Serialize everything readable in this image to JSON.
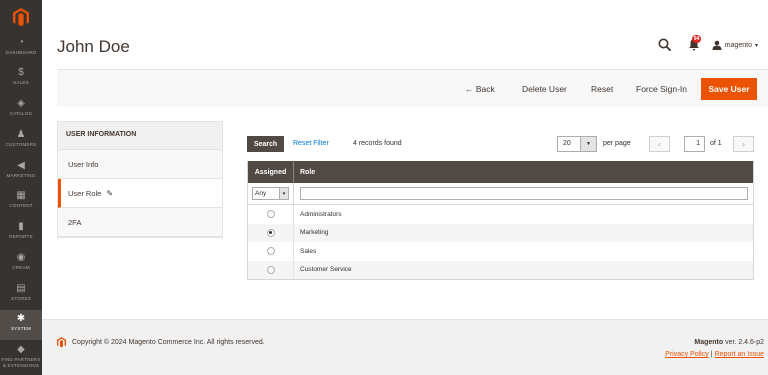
{
  "sidebar": {
    "items": [
      {
        "label": "DASHBOARD",
        "icon": "dashboard-icon",
        "glyph": "◔"
      },
      {
        "label": "SALES",
        "icon": "dollar-icon",
        "glyph": "$"
      },
      {
        "label": "CATALOG",
        "icon": "cube-icon",
        "glyph": "◈"
      },
      {
        "label": "CUSTOMERS",
        "icon": "person-icon",
        "glyph": "♟"
      },
      {
        "label": "MARKETING",
        "icon": "megaphone-icon",
        "glyph": "◀"
      },
      {
        "label": "CONTENT",
        "icon": "content-icon",
        "glyph": "▦"
      },
      {
        "label": "REPORTS",
        "icon": "bar-chart-icon",
        "glyph": "▮"
      },
      {
        "label": "CREAM",
        "icon": "cream-icon",
        "glyph": "◉"
      },
      {
        "label": "STORES",
        "icon": "store-icon",
        "glyph": "▤"
      },
      {
        "label": "SYSTEM",
        "icon": "gear-icon",
        "glyph": "✱"
      },
      {
        "label": "FIND PARTNERS & EXTENSIONS",
        "icon": "extensions-icon",
        "glyph": "◆"
      }
    ]
  },
  "header": {
    "title": "John Doe",
    "notification_count": "94",
    "user": "magento",
    "caret": "▾"
  },
  "actions": {
    "back": "← Back",
    "delete_user": "Delete User",
    "reset": "Reset",
    "force_sign_in": "Force Sign-In",
    "save_user": "Save User"
  },
  "tabs": {
    "title": "USER INFORMATION",
    "items": [
      "User Info",
      "User Role",
      "2FA"
    ],
    "edit_glyph": "✎"
  },
  "grid": {
    "search_label": "Search",
    "reset_filter": "Reset Filter",
    "records_found": "4 records found",
    "page_size": "20",
    "per_page": "per page",
    "current_page": "1",
    "total_pages": "of 1",
    "prev_glyph": "‹",
    "next_glyph": "›",
    "columns": [
      "Assigned",
      "Role"
    ],
    "assigned_filter": "Any",
    "rows": [
      {
        "role": "Administrators",
        "assigned": false
      },
      {
        "role": "Marketing",
        "assigned": true
      },
      {
        "role": "Sales",
        "assigned": false
      },
      {
        "role": "Customer Service",
        "assigned": false
      }
    ]
  },
  "footer": {
    "copyright": "Copyright © 2024 Magento Commerce Inc. All rights reserved.",
    "brand": "Magento",
    "version": " ver. 2.4.6-p2",
    "privacy": "Privacy Policy",
    "separator": "|",
    "report": "Report an Issue"
  },
  "colors": {
    "accent": "#eb5202",
    "sidebar": "#373330",
    "grid_header": "#514943",
    "link": "#007bdb"
  }
}
